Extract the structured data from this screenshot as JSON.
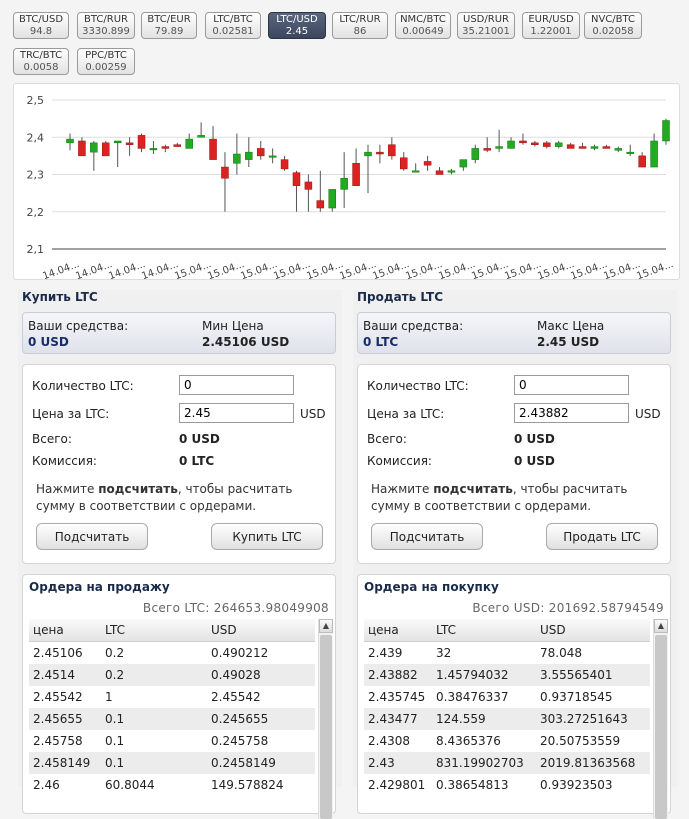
{
  "pairs": [
    {
      "name": "BTC/USD",
      "value": "94.8"
    },
    {
      "name": "BTC/RUR",
      "value": "3330.899"
    },
    {
      "name": "BTC/EUR",
      "value": "79.89"
    },
    {
      "name": "LTC/BTC",
      "value": "0.02581"
    },
    {
      "name": "LTC/USD",
      "value": "2.45",
      "active": true
    },
    {
      "name": "LTC/RUR",
      "value": "86"
    },
    {
      "name": "NMC/BTC",
      "value": "0.00649"
    },
    {
      "name": "USD/RUR",
      "value": "35.21001"
    },
    {
      "name": "EUR/USD",
      "value": "1.22001"
    },
    {
      "name": "NVC/BTC",
      "value": "0.02058"
    },
    {
      "name": "TRC/BTC",
      "value": "0.0058"
    },
    {
      "name": "PPC/BTC",
      "value": "0.00259"
    }
  ],
  "chart_data": {
    "type": "candlestick",
    "y_ticks": [
      "2,5",
      "2,4",
      "2,3",
      "2,2",
      "2,1"
    ],
    "ylim": [
      2.1,
      2.5
    ],
    "x_ticks": [
      "14.04...",
      "14.04...",
      "14.04...",
      "14.04...",
      "15.04...",
      "15.04...",
      "15.04...",
      "15.04...",
      "15.04...",
      "15.04...",
      "15.04...",
      "15.04...",
      "15.04...",
      "15.04...",
      "15.04...",
      "15.04...",
      "15.04...",
      "15.04...",
      "15.04..."
    ],
    "up_color": "#22aa22",
    "down_color": "#dd2222",
    "candles": [
      {
        "o": 2.385,
        "h": 2.41,
        "l": 2.365,
        "c": 2.395
      },
      {
        "o": 2.39,
        "h": 2.4,
        "l": 2.35,
        "c": 2.35
      },
      {
        "o": 2.36,
        "h": 2.39,
        "l": 2.31,
        "c": 2.385
      },
      {
        "o": 2.385,
        "h": 2.39,
        "l": 2.35,
        "c": 2.35
      },
      {
        "o": 2.385,
        "h": 2.39,
        "l": 2.32,
        "c": 2.39
      },
      {
        "o": 2.385,
        "h": 2.4,
        "l": 2.35,
        "c": 2.38
      },
      {
        "o": 2.405,
        "h": 2.41,
        "l": 2.36,
        "c": 2.37
      },
      {
        "o": 2.37,
        "h": 2.39,
        "l": 2.355,
        "c": 2.37
      },
      {
        "o": 2.375,
        "h": 2.38,
        "l": 2.36,
        "c": 2.37
      },
      {
        "o": 2.38,
        "h": 2.385,
        "l": 2.38,
        "c": 2.375
      },
      {
        "o": 2.37,
        "h": 2.41,
        "l": 2.37,
        "c": 2.395
      },
      {
        "o": 2.4,
        "h": 2.44,
        "l": 2.4,
        "c": 2.405
      },
      {
        "o": 2.395,
        "h": 2.43,
        "l": 2.34,
        "c": 2.34
      },
      {
        "o": 2.32,
        "h": 2.36,
        "l": 2.2,
        "c": 2.29
      },
      {
        "o": 2.33,
        "h": 2.41,
        "l": 2.3,
        "c": 2.355
      },
      {
        "o": 2.34,
        "h": 2.4,
        "l": 2.32,
        "c": 2.36
      },
      {
        "o": 2.37,
        "h": 2.39,
        "l": 2.34,
        "c": 2.35
      },
      {
        "o": 2.35,
        "h": 2.37,
        "l": 2.33,
        "c": 2.35
      },
      {
        "o": 2.34,
        "h": 2.35,
        "l": 2.31,
        "c": 2.315
      },
      {
        "o": 2.305,
        "h": 2.31,
        "l": 2.2,
        "c": 2.27
      },
      {
        "o": 2.28,
        "h": 2.3,
        "l": 2.2,
        "c": 2.26
      },
      {
        "o": 2.23,
        "h": 2.31,
        "l": 2.2,
        "c": 2.21
      },
      {
        "o": 2.21,
        "h": 2.26,
        "l": 2.2,
        "c": 2.26
      },
      {
        "o": 2.26,
        "h": 2.36,
        "l": 2.21,
        "c": 2.29
      },
      {
        "o": 2.33,
        "h": 2.37,
        "l": 2.27,
        "c": 2.27
      },
      {
        "o": 2.35,
        "h": 2.38,
        "l": 2.25,
        "c": 2.36
      },
      {
        "o": 2.36,
        "h": 2.38,
        "l": 2.33,
        "c": 2.355
      },
      {
        "o": 2.38,
        "h": 2.4,
        "l": 2.34,
        "c": 2.35
      },
      {
        "o": 2.345,
        "h": 2.36,
        "l": 2.31,
        "c": 2.315
      },
      {
        "o": 2.31,
        "h": 2.33,
        "l": 2.31,
        "c": 2.31
      },
      {
        "o": 2.335,
        "h": 2.35,
        "l": 2.31,
        "c": 2.325
      },
      {
        "o": 2.31,
        "h": 2.32,
        "l": 2.3,
        "c": 2.3
      },
      {
        "o": 2.31,
        "h": 2.315,
        "l": 2.3,
        "c": 2.31
      },
      {
        "o": 2.32,
        "h": 2.34,
        "l": 2.31,
        "c": 2.34
      },
      {
        "o": 2.34,
        "h": 2.38,
        "l": 2.33,
        "c": 2.37
      },
      {
        "o": 2.37,
        "h": 2.4,
        "l": 2.36,
        "c": 2.365
      },
      {
        "o": 2.37,
        "h": 2.42,
        "l": 2.36,
        "c": 2.375
      },
      {
        "o": 2.37,
        "h": 2.4,
        "l": 2.37,
        "c": 2.39
      },
      {
        "o": 2.39,
        "h": 2.41,
        "l": 2.38,
        "c": 2.385
      },
      {
        "o": 2.385,
        "h": 2.39,
        "l": 2.375,
        "c": 2.38
      },
      {
        "o": 2.385,
        "h": 2.39,
        "l": 2.37,
        "c": 2.375
      },
      {
        "o": 2.375,
        "h": 2.39,
        "l": 2.37,
        "c": 2.385
      },
      {
        "o": 2.38,
        "h": 2.385,
        "l": 2.37,
        "c": 2.37
      },
      {
        "o": 2.375,
        "h": 2.385,
        "l": 2.37,
        "c": 2.37
      },
      {
        "o": 2.37,
        "h": 2.38,
        "l": 2.365,
        "c": 2.375
      },
      {
        "o": 2.375,
        "h": 2.38,
        "l": 2.37,
        "c": 2.37
      },
      {
        "o": 2.365,
        "h": 2.375,
        "l": 2.36,
        "c": 2.37
      },
      {
        "o": 2.36,
        "h": 2.38,
        "l": 2.35,
        "c": 2.36
      },
      {
        "o": 2.35,
        "h": 2.36,
        "l": 2.32,
        "c": 2.32
      },
      {
        "o": 2.32,
        "h": 2.41,
        "l": 2.32,
        "c": 2.39
      },
      {
        "o": 2.39,
        "h": 2.45,
        "l": 2.38,
        "c": 2.445
      }
    ]
  },
  "buy": {
    "title": "Купить LTC",
    "funds_label": "Ваши средства:",
    "funds_value": "0 USD",
    "price_label": "Мин Цена",
    "price_value": "2.45106 USD",
    "qty_label": "Количество LTC:",
    "qty_value": "0",
    "rate_label": "Цена за LTC:",
    "rate_value": "2.45",
    "rate_unit": "USD",
    "total_label": "Всего:",
    "total_value": "0 USD",
    "fee_label": "Комиссия:",
    "fee_value": "0 LTC",
    "hint_pre": "Нажмите ",
    "hint_bold": "подсчитать",
    "hint_post": ", чтобы расчитать сумму в соответствии с ордерами.",
    "calc_button": "Подсчитать",
    "action_button": "Купить LTC"
  },
  "sell": {
    "title": "Продать LTC",
    "funds_label": "Ваши средства:",
    "funds_value": "0 LTC",
    "price_label": "Макс Цена",
    "price_value": "2.45 USD",
    "qty_label": "Количество LTC:",
    "qty_value": "0",
    "rate_label": "Цена за LTC:",
    "rate_value": "2.43882",
    "rate_unit": "USD",
    "total_label": "Всего:",
    "total_value": "0 USD",
    "fee_label": "Комиссия:",
    "fee_value": "0 USD",
    "hint_pre": "Нажмите ",
    "hint_bold": "подсчитать",
    "hint_post": ", чтобы расчитать сумму в соответствии с ордерами.",
    "calc_button": "Подсчитать",
    "action_button": "Продать LTC"
  },
  "sell_orders": {
    "title": "Ордера на продажу",
    "total": "Всего LTC: 264653.98049908",
    "headers": [
      "цена",
      "LTC",
      "USD"
    ],
    "rows": [
      [
        "2.45106",
        "0.2",
        "0.490212"
      ],
      [
        "2.4514",
        "0.2",
        "0.49028"
      ],
      [
        "2.45542",
        "1",
        "2.45542"
      ],
      [
        "2.45655",
        "0.1",
        "0.245655"
      ],
      [
        "2.45758",
        "0.1",
        "0.245758"
      ],
      [
        "2.458149",
        "0.1",
        "0.2458149"
      ],
      [
        "2.46",
        "60.8044",
        "149.578824"
      ]
    ]
  },
  "buy_orders": {
    "title": "Ордера на покупку",
    "total": "Всего USD: 201692.58794549",
    "headers": [
      "цена",
      "LTC",
      "USD"
    ],
    "rows": [
      [
        "2.439",
        "32",
        "78.048"
      ],
      [
        "2.43882",
        "1.45794032",
        "3.55565401"
      ],
      [
        "2.435745",
        "0.38476337",
        "0.93718545"
      ],
      [
        "2.43477",
        "124.559",
        "303.27251643"
      ],
      [
        "2.4308",
        "8.4365376",
        "20.50753559"
      ],
      [
        "2.43",
        "831.19902703",
        "2019.81363568"
      ],
      [
        "2.429801",
        "0.38654813",
        "0.93923503"
      ]
    ]
  }
}
